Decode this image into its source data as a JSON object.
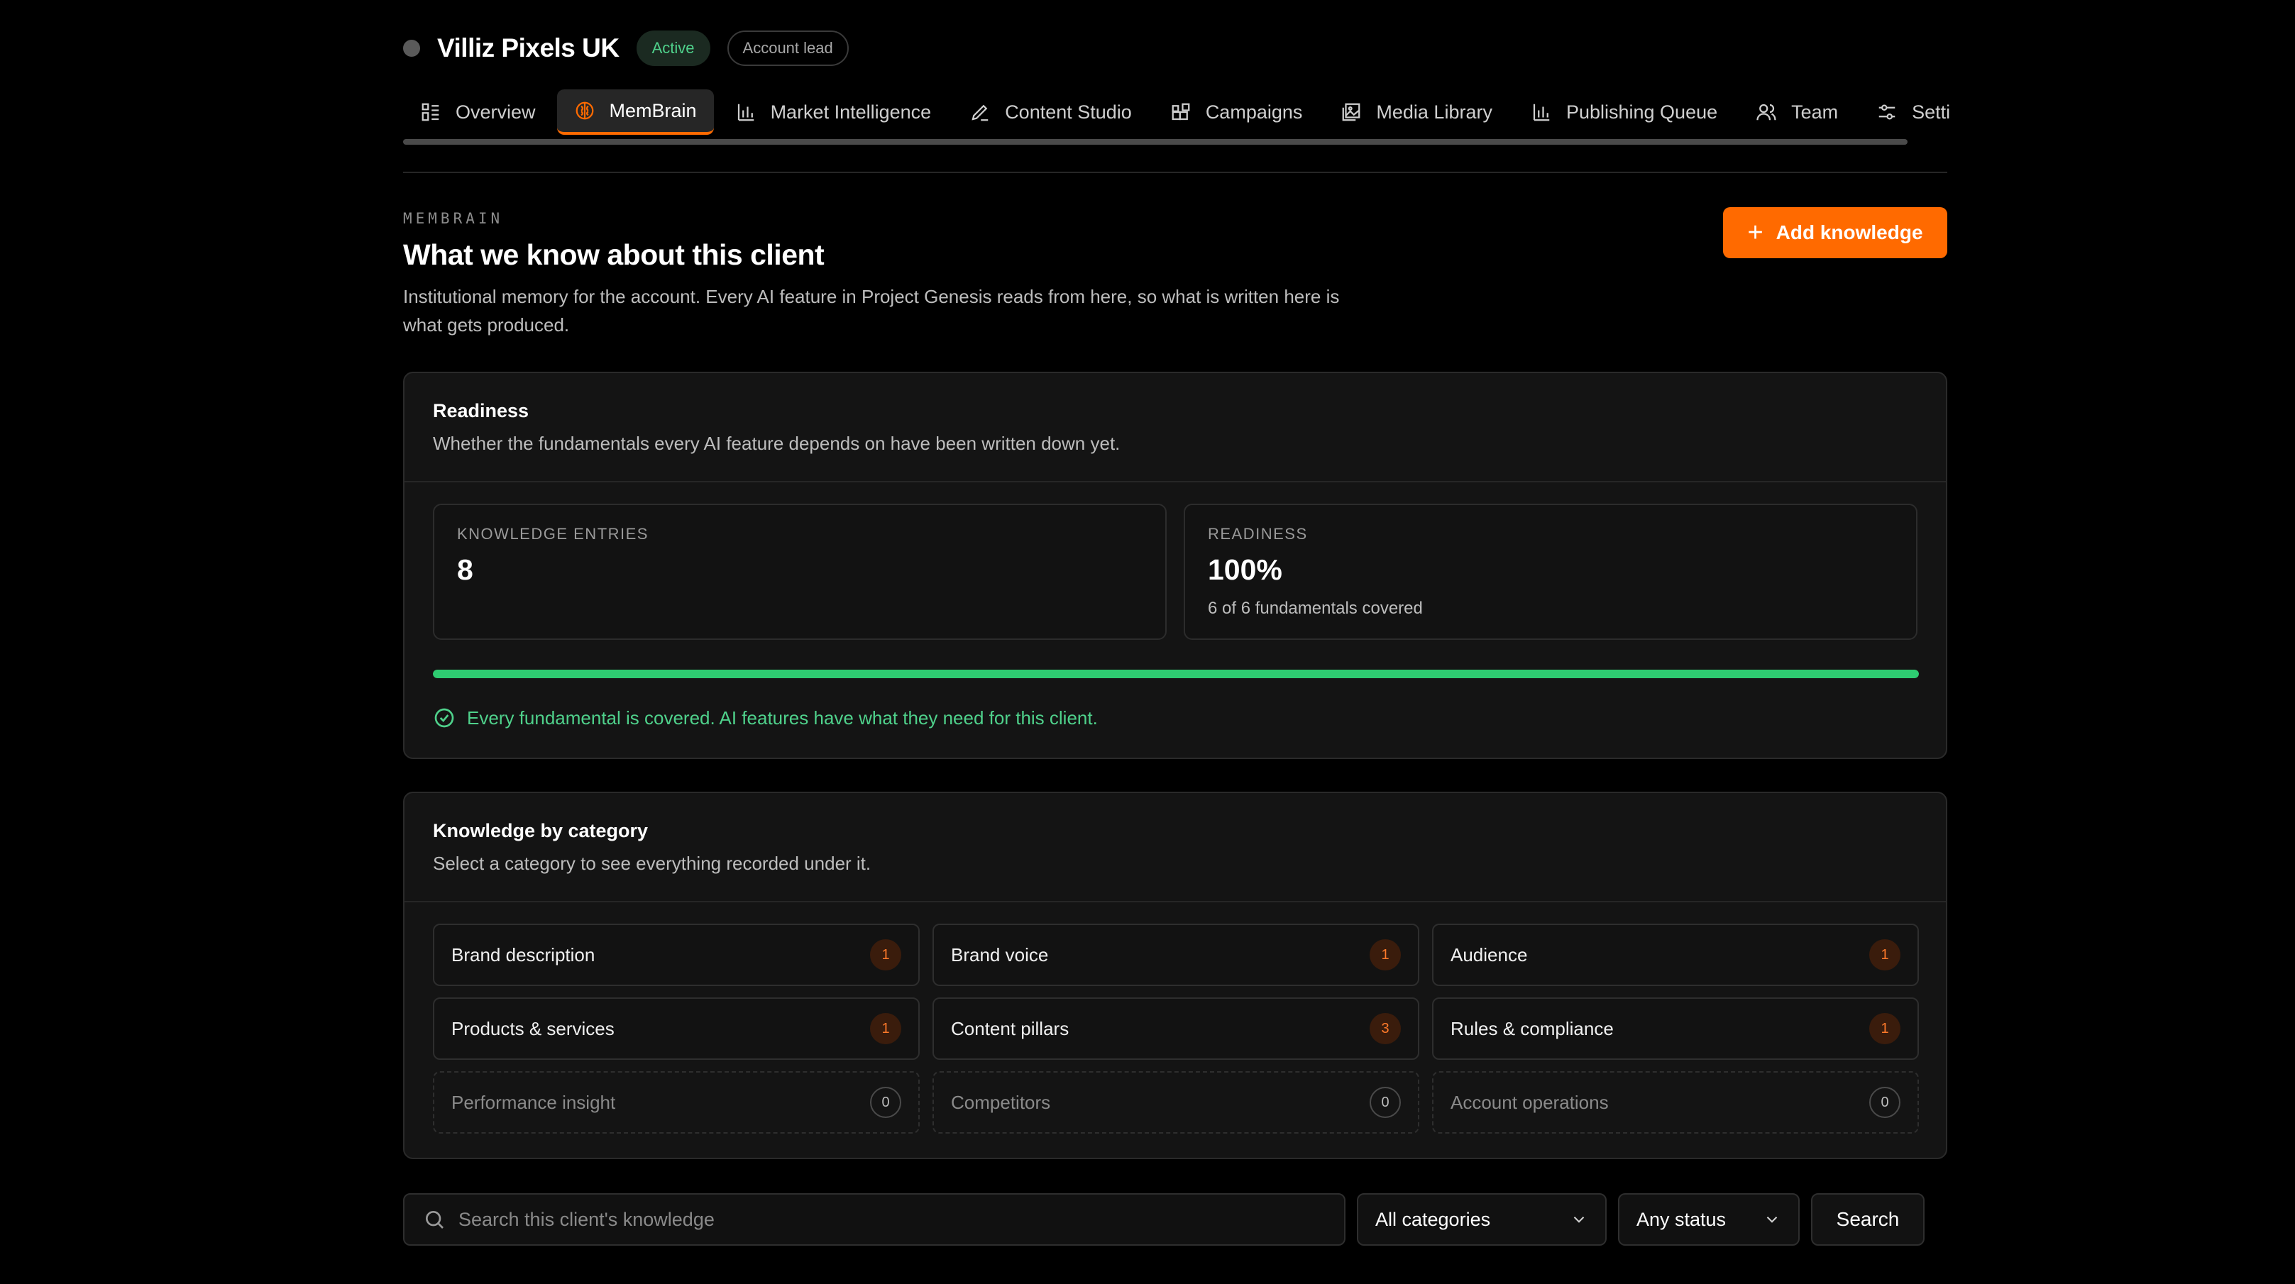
{
  "header": {
    "client_name": "Villiz Pixels UK",
    "status_badge": "Active",
    "role_badge": "Account lead"
  },
  "tabs": [
    {
      "label": "Overview",
      "icon": "grid-list-icon",
      "active": false
    },
    {
      "label": "MemBrain",
      "icon": "brain-icon",
      "active": true
    },
    {
      "label": "Market Intelligence",
      "icon": "bar-chart-icon",
      "active": false
    },
    {
      "label": "Content Studio",
      "icon": "pen-icon",
      "active": false
    },
    {
      "label": "Campaigns",
      "icon": "blocks-icon",
      "active": false
    },
    {
      "label": "Media Library",
      "icon": "image-stack-icon",
      "active": false
    },
    {
      "label": "Publishing Queue",
      "icon": "bar-chart-icon",
      "active": false
    },
    {
      "label": "Team",
      "icon": "users-icon",
      "active": false
    },
    {
      "label": "Settin",
      "icon": "sliders-icon",
      "active": false
    }
  ],
  "section": {
    "eyebrow": "MEMBRAIN",
    "title": "What we know about this client",
    "description": "Institutional memory for the account. Every AI feature in Project Genesis reads from here, so what is written here is what gets produced.",
    "add_button": "Add knowledge"
  },
  "readiness": {
    "title": "Readiness",
    "subtitle": "Whether the fundamentals every AI feature depends on have been written down yet.",
    "entries_label": "KNOWLEDGE ENTRIES",
    "entries_value": "8",
    "readiness_label": "READINESS",
    "readiness_value": "100%",
    "readiness_note": "6 of 6 fundamentals covered",
    "progress": 1.0,
    "ok_message": "Every fundamental is covered. AI features have what they need for this client."
  },
  "categories": {
    "title": "Knowledge by category",
    "subtitle": "Select a category to see everything recorded under it.",
    "items": [
      {
        "label": "Brand description",
        "count": "1"
      },
      {
        "label": "Brand voice",
        "count": "1"
      },
      {
        "label": "Audience",
        "count": "1"
      },
      {
        "label": "Products & services",
        "count": "1"
      },
      {
        "label": "Content pillars",
        "count": "3"
      },
      {
        "label": "Rules & compliance",
        "count": "1"
      },
      {
        "label": "Performance insight",
        "count": "0"
      },
      {
        "label": "Competitors",
        "count": "0"
      },
      {
        "label": "Account operations",
        "count": "0"
      }
    ]
  },
  "filters": {
    "search_placeholder": "Search this client's knowledge",
    "category_select": "All categories",
    "status_select": "Any status",
    "search_button": "Search"
  },
  "colors": {
    "accent": "#ff6a00",
    "success": "#2ecc71",
    "background": "#000000",
    "card": "#141414"
  }
}
